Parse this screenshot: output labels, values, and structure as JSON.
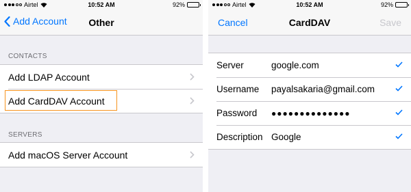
{
  "left": {
    "status": {
      "carrier": "Airtel",
      "time": "10:52 AM",
      "battery": "92%"
    },
    "nav": {
      "back_label": "Add Account",
      "title": "Other"
    },
    "contacts_header": "CONTACTS",
    "contacts_items": [
      {
        "label": "Add LDAP Account"
      },
      {
        "label": "Add CardDAV Account"
      }
    ],
    "servers_header": "SERVERS",
    "servers_items": [
      {
        "label": "Add macOS Server Account"
      }
    ]
  },
  "right": {
    "status": {
      "carrier": "Airtel",
      "time": "10:52 AM",
      "battery": "92%"
    },
    "nav": {
      "cancel_label": "Cancel",
      "title": "CardDAV",
      "save_label": "Save"
    },
    "fields": [
      {
        "label": "Server",
        "value": "google.com"
      },
      {
        "label": "Username",
        "value": "payalsakaria@gmail.com"
      },
      {
        "label": "Password",
        "value": "●●●●●●●●●●●●●●"
      },
      {
        "label": "Description",
        "value": "Google"
      }
    ]
  },
  "colors": {
    "accent": "#0076ff",
    "highlight": "#f7931e",
    "background": "#efeff4",
    "disabled": "#c7c7cc"
  },
  "battery_level": 0.92
}
